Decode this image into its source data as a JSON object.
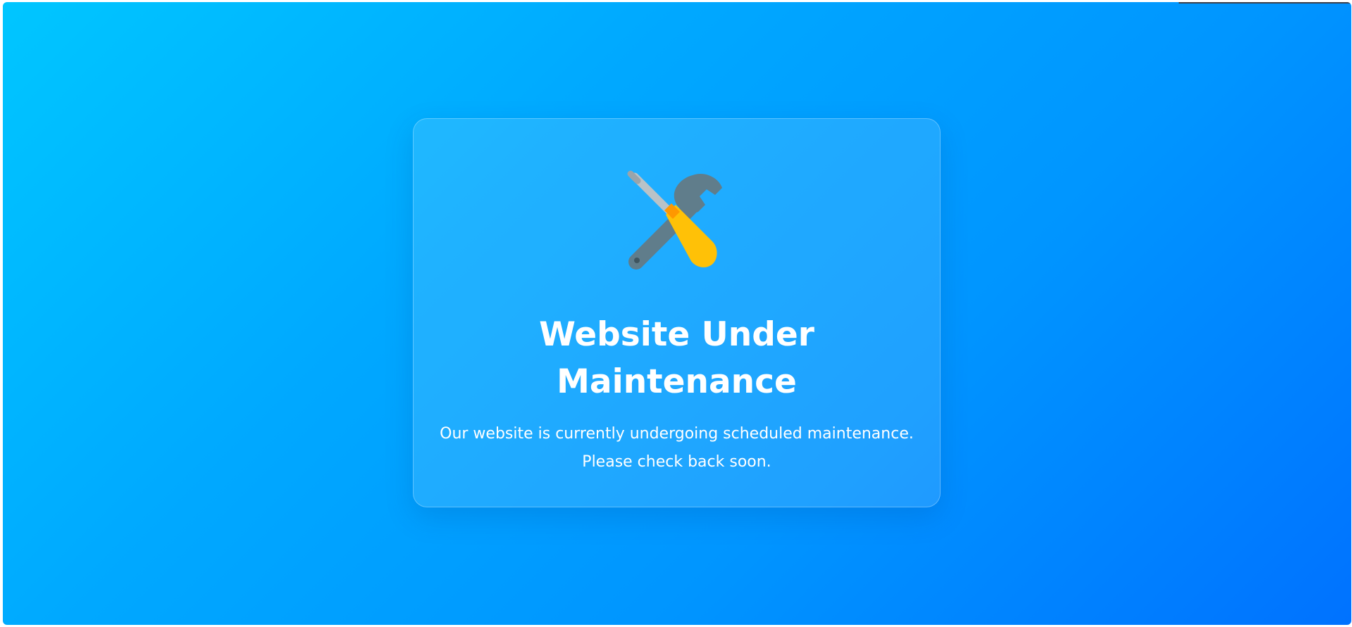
{
  "page": {
    "background_gradient": [
      "#00c6ff",
      "#0072ff"
    ]
  },
  "card": {
    "icon": "hammer-and-wrench-icon",
    "title_line1": "Website Under",
    "title_line2": "Maintenance",
    "message_line1": "Our website is currently undergoing scheduled maintenance.",
    "message_line2": "Please check back soon."
  }
}
